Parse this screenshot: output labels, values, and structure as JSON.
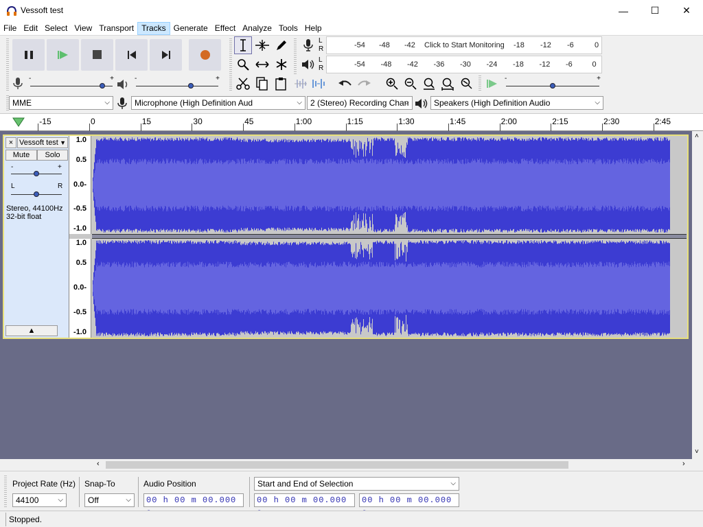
{
  "window": {
    "title": "Vessoft test",
    "minimize": "—",
    "maximize": "☐",
    "close": "✕"
  },
  "menu": [
    "File",
    "Edit",
    "Select",
    "View",
    "Transport",
    "Tracks",
    "Generate",
    "Effect",
    "Analyze",
    "Tools",
    "Help"
  ],
  "active_menu": "Tracks",
  "transport": {
    "buttons": [
      {
        "name": "pause-button",
        "icon": "pause-icon"
      },
      {
        "name": "play-button",
        "icon": "play-icon"
      },
      {
        "name": "stop-button",
        "icon": "stop-icon"
      },
      {
        "name": "skip-start-button",
        "icon": "skip-start-icon"
      },
      {
        "name": "skip-end-button",
        "icon": "skip-end-icon"
      },
      {
        "name": "record-button",
        "icon": "record-icon"
      }
    ],
    "record_color": "#d36a23",
    "play_color": "#5dbf6e"
  },
  "meters": {
    "record_ticks": [
      "-54",
      "-48",
      "-42",
      "Click to Start Monitoring",
      "-18",
      "-12",
      "-6",
      "0"
    ],
    "playback_ticks": [
      "-54",
      "-48",
      "-42",
      "-36",
      "-30",
      "-24",
      "-18",
      "-12",
      "-6",
      "0"
    ],
    "channel_L": "L",
    "channel_R": "R"
  },
  "mixer": {
    "recording_volume": 0.9,
    "playback_volume": 0.68,
    "play_speed": 0.5
  },
  "devices": {
    "host": "MME",
    "recording_device": "Microphone (High Definition Aud",
    "channels": "2 (Stereo) Recording Chan",
    "playback_device": "Speakers (High Definition Audio"
  },
  "ruler": {
    "ticks": [
      "-15",
      "0",
      "15",
      "30",
      "45",
      "1:00",
      "1:15",
      "1:30",
      "1:45",
      "2:00",
      "2:15",
      "2:30",
      "2:45"
    ]
  },
  "track": {
    "name": "Vessoft test",
    "mute": "Mute",
    "solo": "Solo",
    "gain_minus": "-",
    "gain_plus": "+",
    "pan_left": "L",
    "pan_right": "R",
    "info_line1": "Stereo, 44100Hz",
    "info_line2": "32-bit float",
    "close": "×",
    "collapse": "▲",
    "scale": [
      "1.0",
      "0.5",
      "0.0-",
      "-0.5",
      "-1.0"
    ],
    "wave_color": "#3c3cd2",
    "rms_color": "#6464e0"
  },
  "selection_toolbar": {
    "project_rate_label": "Project Rate (Hz)",
    "project_rate": "44100",
    "snap_label": "Snap-To",
    "snap_value": "Off",
    "audio_position_label": "Audio Position",
    "audio_position": "00 h 00 m 00.000 s",
    "selection_mode": "Start and End of Selection",
    "selection_start": "00 h 00 m 00.000 s",
    "selection_end": "00 h 00 m 00.000 s"
  },
  "status": "Stopped."
}
